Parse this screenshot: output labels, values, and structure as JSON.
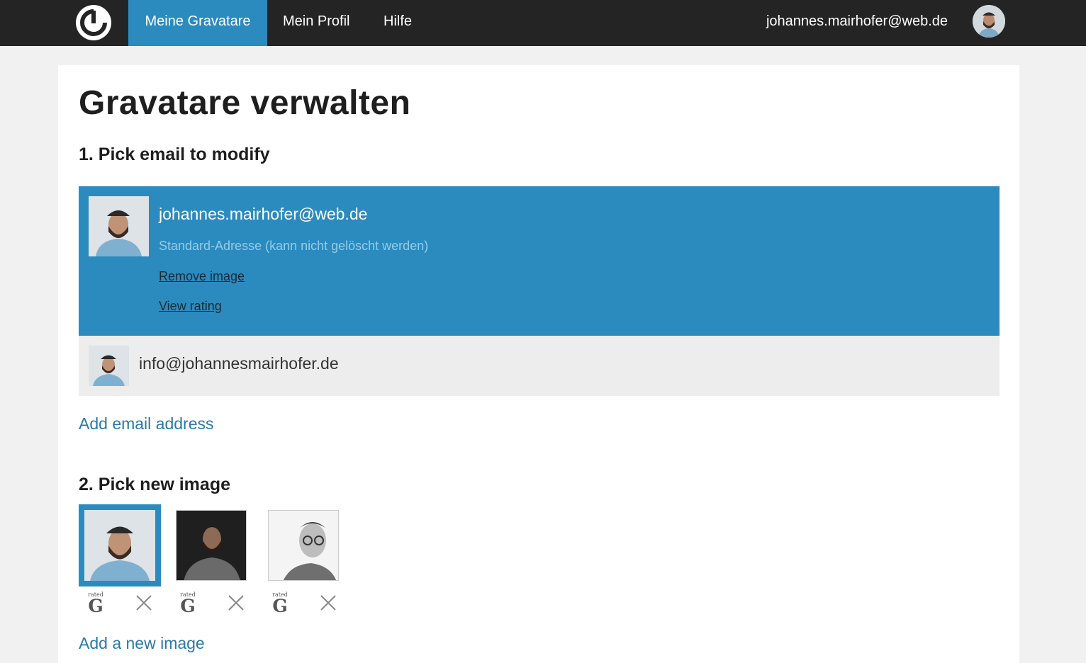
{
  "nav": {
    "items": [
      "Meine Gravatare",
      "Mein Profil",
      "Hilfe"
    ],
    "user_email": "johannes.mairhofer@web.de",
    "accent": "#2b8bbf"
  },
  "page": {
    "title": "Gravatare verwalten",
    "step1_title": "1. Pick email to modify",
    "step2_title": "2. Pick new image"
  },
  "emails": {
    "active": {
      "address": "johannes.mairhofer@web.de",
      "note": "Standard-Adresse (kann nicht gelöscht werden)",
      "remove_link": "Remove image",
      "rating_link": "View rating"
    },
    "other": "info@johannesmairhofer.de",
    "add_label": "Add email address"
  },
  "images": {
    "rating_small": "rated",
    "rating_letter": "G",
    "add_label": "Add a new image"
  }
}
